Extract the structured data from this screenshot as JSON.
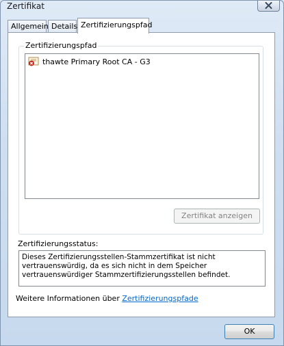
{
  "window": {
    "title": "Zertifikat"
  },
  "tabs": [
    {
      "label": "Allgemein",
      "active": false
    },
    {
      "label": "Details",
      "active": false
    },
    {
      "label": "Zertifizierungspfad",
      "active": true
    }
  ],
  "path_group": {
    "label": "Zertifizierungspfad",
    "items": [
      {
        "label": "thawte Primary Root CA - G3",
        "icon": "certificate-error-icon"
      }
    ],
    "view_button_label": "Zertifikat anzeigen",
    "view_button_enabled": false
  },
  "status": {
    "label": "Zertifizierungsstatus:",
    "text": "Dieses Zertifizierungsstellen-Stammzertifikat ist nicht vertrauenswürdig, da es sich nicht in dem Speicher vertrauenswürdiger Stammzertifizierungsstellen befindet."
  },
  "more_info": {
    "prefix": "Weitere Informationen über",
    "link_label": "Zertifizierungspfade"
  },
  "buttons": {
    "ok_label": "OK"
  },
  "colors": {
    "link": "#0066cc",
    "error_badge": "#d9261c"
  }
}
